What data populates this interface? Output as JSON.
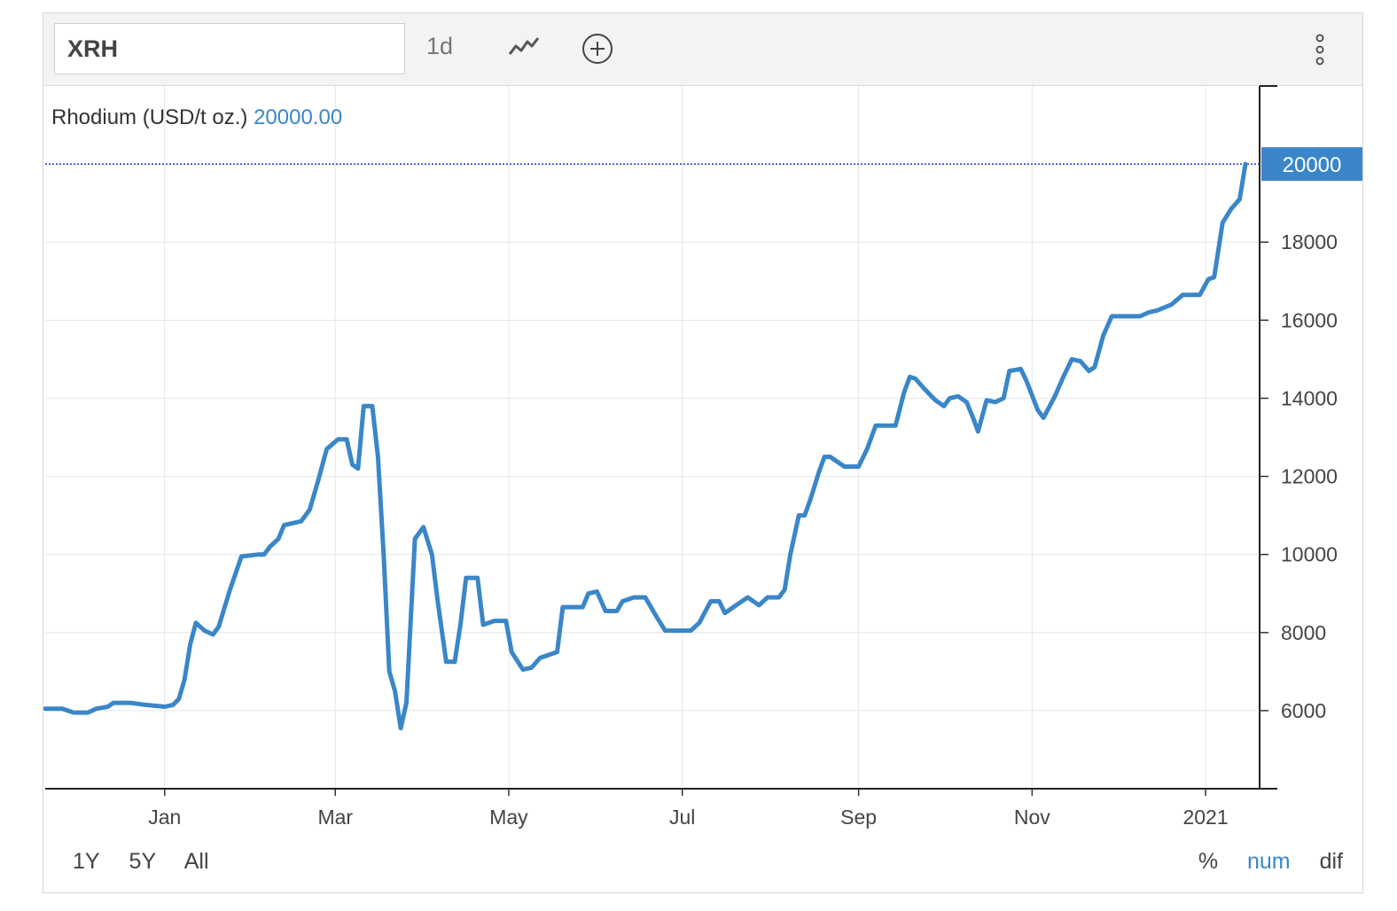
{
  "toolbar": {
    "symbol": "XRH",
    "interval_label": "1d",
    "chart_type_icon": "line-chart-icon",
    "add_icon": "plus-circle-icon",
    "menu_icon": "vertical-dots-icon"
  },
  "legend": {
    "name": "Rhodium (USD/t oz.)",
    "value": "20000.00"
  },
  "last_price_label": "20000",
  "ranges": [
    "1Y",
    "5Y",
    "All"
  ],
  "modes": [
    {
      "label": "%",
      "active": false
    },
    {
      "label": "num",
      "active": true
    },
    {
      "label": "dif",
      "active": false
    }
  ],
  "colors": {
    "line": "#3a86c8",
    "last_price_badge": "#3a86c8",
    "last_price_line": "#2233cc"
  },
  "chart_data": {
    "type": "line",
    "title": "",
    "xlabel": "",
    "ylabel": "",
    "ylim": [
      4000,
      22000
    ],
    "y_ticks": [
      6000,
      8000,
      10000,
      12000,
      14000,
      16000,
      18000
    ],
    "x_ticks": [
      {
        "label": "Jan",
        "date": "2020-01-01"
      },
      {
        "label": "Mar",
        "date": "2020-03-01"
      },
      {
        "label": "May",
        "date": "2020-05-01"
      },
      {
        "label": "Jul",
        "date": "2020-07-01"
      },
      {
        "label": "Sep",
        "date": "2020-09-01"
      },
      {
        "label": "Nov",
        "date": "2020-11-01"
      },
      {
        "label": "2021",
        "date": "2021-01-01"
      }
    ],
    "xlim": [
      "2019-11-20",
      "2021-01-20"
    ],
    "grid": true,
    "series": [
      {
        "name": "Rhodium (USD/t oz.)",
        "points": [
          [
            "2019-11-20",
            6050
          ],
          [
            "2019-11-26",
            6050
          ],
          [
            "2019-11-30",
            5950
          ],
          [
            "2019-12-05",
            5950
          ],
          [
            "2019-12-08",
            6050
          ],
          [
            "2019-12-12",
            6100
          ],
          [
            "2019-12-14",
            6200
          ],
          [
            "2019-12-20",
            6200
          ],
          [
            "2019-12-25",
            6150
          ],
          [
            "2020-01-01",
            6100
          ],
          [
            "2020-01-04",
            6150
          ],
          [
            "2020-01-06",
            6300
          ],
          [
            "2020-01-08",
            6800
          ],
          [
            "2020-01-10",
            7700
          ],
          [
            "2020-01-12",
            8250
          ],
          [
            "2020-01-15",
            8050
          ],
          [
            "2020-01-18",
            7950
          ],
          [
            "2020-01-20",
            8150
          ],
          [
            "2020-01-24",
            9100
          ],
          [
            "2020-01-28",
            9950
          ],
          [
            "2020-02-03",
            10000
          ],
          [
            "2020-02-05",
            10000
          ],
          [
            "2020-02-07",
            10200
          ],
          [
            "2020-02-10",
            10400
          ],
          [
            "2020-02-12",
            10750
          ],
          [
            "2020-02-18",
            10850
          ],
          [
            "2020-02-21",
            11150
          ],
          [
            "2020-02-24",
            11900
          ],
          [
            "2020-02-27",
            12700
          ],
          [
            "2020-03-02",
            12950
          ],
          [
            "2020-03-05",
            12950
          ],
          [
            "2020-03-07",
            12300
          ],
          [
            "2020-03-09",
            12200
          ],
          [
            "2020-03-11",
            13800
          ],
          [
            "2020-03-14",
            13800
          ],
          [
            "2020-03-16",
            12500
          ],
          [
            "2020-03-18",
            10000
          ],
          [
            "2020-03-20",
            7000
          ],
          [
            "2020-03-22",
            6500
          ],
          [
            "2020-03-24",
            5550
          ],
          [
            "2020-03-26",
            6200
          ],
          [
            "2020-03-29",
            10400
          ],
          [
            "2020-04-01",
            10700
          ],
          [
            "2020-04-04",
            10000
          ],
          [
            "2020-04-06",
            8800
          ],
          [
            "2020-04-09",
            7250
          ],
          [
            "2020-04-12",
            7250
          ],
          [
            "2020-04-14",
            8200
          ],
          [
            "2020-04-16",
            9400
          ],
          [
            "2020-04-20",
            9400
          ],
          [
            "2020-04-22",
            8200
          ],
          [
            "2020-04-26",
            8300
          ],
          [
            "2020-04-30",
            8300
          ],
          [
            "2020-05-02",
            7500
          ],
          [
            "2020-05-06",
            7050
          ],
          [
            "2020-05-09",
            7100
          ],
          [
            "2020-05-12",
            7350
          ],
          [
            "2020-05-16",
            7450
          ],
          [
            "2020-05-18",
            7500
          ],
          [
            "2020-05-20",
            8650
          ],
          [
            "2020-05-25",
            8650
          ],
          [
            "2020-05-27",
            8650
          ],
          [
            "2020-05-29",
            9000
          ],
          [
            "2020-06-01",
            9050
          ],
          [
            "2020-06-04",
            8550
          ],
          [
            "2020-06-08",
            8550
          ],
          [
            "2020-06-10",
            8800
          ],
          [
            "2020-06-14",
            8900
          ],
          [
            "2020-06-18",
            8900
          ],
          [
            "2020-06-22",
            8400
          ],
          [
            "2020-06-25",
            8050
          ],
          [
            "2020-06-30",
            8050
          ],
          [
            "2020-07-04",
            8050
          ],
          [
            "2020-07-07",
            8250
          ],
          [
            "2020-07-11",
            8800
          ],
          [
            "2020-07-14",
            8800
          ],
          [
            "2020-07-16",
            8500
          ],
          [
            "2020-07-19",
            8650
          ],
          [
            "2020-07-24",
            8900
          ],
          [
            "2020-07-28",
            8700
          ],
          [
            "2020-07-31",
            8900
          ],
          [
            "2020-08-04",
            8900
          ],
          [
            "2020-08-06",
            9100
          ],
          [
            "2020-08-08",
            10000
          ],
          [
            "2020-08-11",
            11000
          ],
          [
            "2020-08-13",
            11000
          ],
          [
            "2020-08-15",
            11400
          ],
          [
            "2020-08-18",
            12100
          ],
          [
            "2020-08-20",
            12500
          ],
          [
            "2020-08-22",
            12500
          ],
          [
            "2020-08-27",
            12250
          ],
          [
            "2020-09-01",
            12250
          ],
          [
            "2020-09-04",
            12700
          ],
          [
            "2020-09-07",
            13300
          ],
          [
            "2020-09-14",
            13300
          ],
          [
            "2020-09-17",
            14150
          ],
          [
            "2020-09-19",
            14550
          ],
          [
            "2020-09-21",
            14500
          ],
          [
            "2020-09-24",
            14250
          ],
          [
            "2020-09-28",
            13950
          ],
          [
            "2020-10-01",
            13800
          ],
          [
            "2020-10-03",
            14000
          ],
          [
            "2020-10-06",
            14050
          ],
          [
            "2020-10-09",
            13900
          ],
          [
            "2020-10-11",
            13550
          ],
          [
            "2020-10-13",
            13150
          ],
          [
            "2020-10-16",
            13950
          ],
          [
            "2020-10-19",
            13900
          ],
          [
            "2020-10-22",
            14000
          ],
          [
            "2020-10-24",
            14700
          ],
          [
            "2020-10-28",
            14750
          ],
          [
            "2020-10-30",
            14450
          ],
          [
            "2020-11-03",
            13700
          ],
          [
            "2020-11-05",
            13500
          ],
          [
            "2020-11-09",
            14050
          ],
          [
            "2020-11-12",
            14550
          ],
          [
            "2020-11-15",
            15000
          ],
          [
            "2020-11-18",
            14950
          ],
          [
            "2020-11-21",
            14700
          ],
          [
            "2020-11-23",
            14800
          ],
          [
            "2020-11-26",
            15600
          ],
          [
            "2020-11-29",
            16100
          ],
          [
            "2020-12-09",
            16100
          ],
          [
            "2020-12-12",
            16200
          ],
          [
            "2020-12-15",
            16250
          ],
          [
            "2020-12-20",
            16400
          ],
          [
            "2020-12-24",
            16650
          ],
          [
            "2020-12-30",
            16650
          ],
          [
            "2021-01-02",
            17050
          ],
          [
            "2021-01-04",
            17100
          ],
          [
            "2021-01-07",
            18500
          ],
          [
            "2021-01-10",
            18850
          ],
          [
            "2021-01-13",
            19100
          ],
          [
            "2021-01-15",
            20000
          ]
        ]
      }
    ]
  }
}
